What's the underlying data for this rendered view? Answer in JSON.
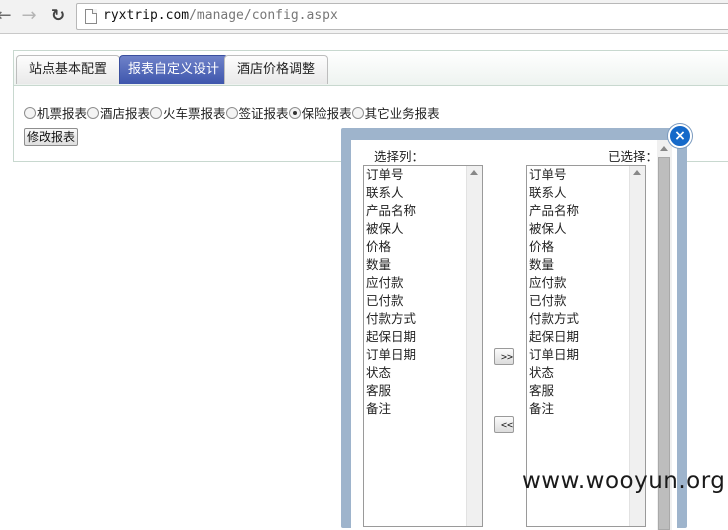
{
  "browser": {
    "url_host": "ryxtrip.com",
    "url_path": "/manage/config.aspx"
  },
  "tabs": [
    {
      "label": "站点基本配置"
    },
    {
      "label": "报表自定义设计"
    },
    {
      "label": "酒店价格调整"
    }
  ],
  "report_types": [
    {
      "label": "机票报表",
      "checked": false
    },
    {
      "label": "酒店报表",
      "checked": false
    },
    {
      "label": "火车票报表",
      "checked": false
    },
    {
      "label": "签证报表",
      "checked": false
    },
    {
      "label": "保险报表",
      "checked": true
    },
    {
      "label": "其它业务报表",
      "checked": false
    }
  ],
  "modify_button": "修改报表",
  "dialog": {
    "close_label": "×",
    "left_label": "选择列：",
    "right_label": "已选择：",
    "left_items": [
      "订单号",
      "联系人",
      "产品名称",
      "被保人",
      "价格",
      "数量",
      "应付款",
      "已付款",
      "付款方式",
      "起保日期",
      "订单日期",
      "状态",
      "客服",
      "备注"
    ],
    "right_items": [
      "订单号",
      "联系人",
      "产品名称",
      "被保人",
      "价格",
      "数量",
      "应付款",
      "已付款",
      "付款方式",
      "起保日期",
      "订单日期",
      "状态",
      "客服",
      "备注"
    ],
    "add_button": ">>",
    "remove_button": "<<"
  },
  "watermark": "www.wooyun.org"
}
